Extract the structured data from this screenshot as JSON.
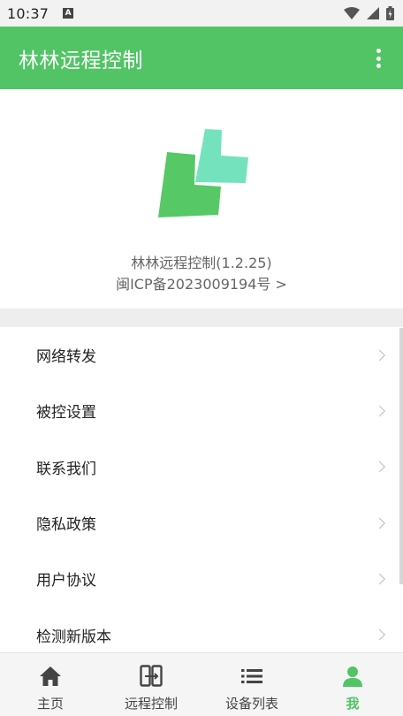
{
  "status_bar": {
    "time": "10:37",
    "notification_icon_letter": "A"
  },
  "app_bar": {
    "title": "林林远程控制"
  },
  "about": {
    "app_version": "林林远程控制(1.2.25)",
    "icp": "闽ICP备2023009194号 >",
    "logo_colors": {
      "left": "#56c865",
      "right": "#74e3bd"
    }
  },
  "menu": {
    "items": [
      {
        "label": "网络转发"
      },
      {
        "label": "被控设置"
      },
      {
        "label": "联系我们"
      },
      {
        "label": "隐私政策"
      },
      {
        "label": "用户协议"
      },
      {
        "label": "检测新版本"
      }
    ]
  },
  "bottom_nav": {
    "items": [
      {
        "label": "主页",
        "icon": "home-icon"
      },
      {
        "label": "远程控制",
        "icon": "remote-control-icon"
      },
      {
        "label": "设备列表",
        "icon": "list-icon"
      },
      {
        "label": "我",
        "icon": "person-icon",
        "active": true
      }
    ]
  },
  "colors": {
    "accent": "#52c466",
    "background_band": "#eeeeee"
  }
}
